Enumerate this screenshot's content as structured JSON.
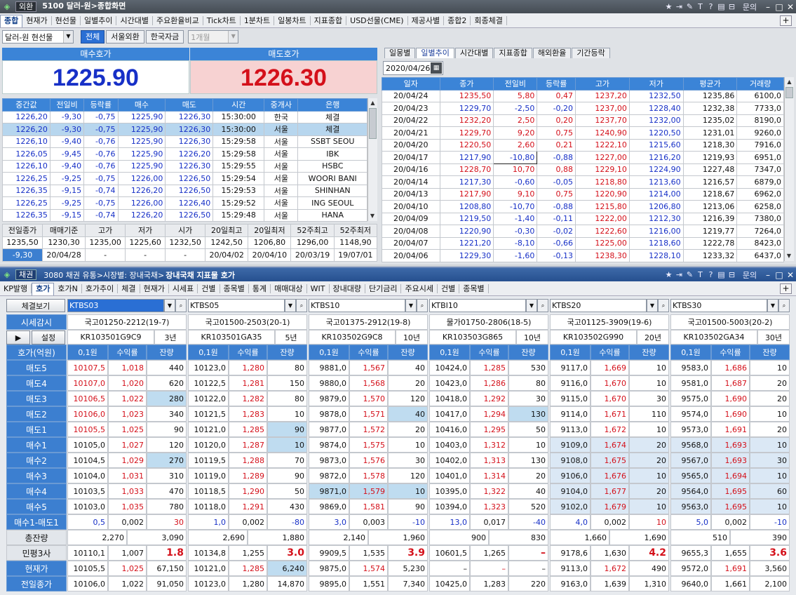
{
  "w1": {
    "tag": "외환",
    "chip": "5100 달러-원>종합화면",
    "menu": [
      "종합",
      "현재가",
      "현선물",
      "일별추이",
      "시간대별",
      "주요환율비교",
      "Tick차트",
      "1분차트",
      "일봉차트",
      "지표종합",
      "USD선물(CME)",
      "제공사별",
      "종합2",
      "회종체결"
    ],
    "sel": "달러-원 현선물",
    "seg": [
      "전체",
      "서울외환",
      "한국자금"
    ],
    "period": "1개월",
    "bid_label": "매수호가",
    "bid": "1225.90",
    "ask_label": "매도호가",
    "ask": "1226.30"
  },
  "trades": {
    "head": [
      "중간값",
      "전일비",
      "등락률",
      "매수",
      "매도",
      "시간",
      "중개사",
      "은행"
    ],
    "rows": [
      [
        "1226,20",
        "-9,30",
        "-0,75",
        "1225,90",
        "1226,30",
        "15:30:00",
        "한국",
        "체결"
      ],
      [
        "1226,20",
        "-9,30",
        "-0,75",
        "1225,90",
        "1226,30",
        "15:30:00",
        "서울",
        "체결"
      ],
      [
        "1226,10",
        "-9,40",
        "-0,76",
        "1225,90",
        "1226,30",
        "15:29:58",
        "서울",
        "SSBT SEOU"
      ],
      [
        "1226,05",
        "-9,45",
        "-0,76",
        "1225,90",
        "1226,20",
        "15:29:58",
        "서울",
        "IBK"
      ],
      [
        "1226,10",
        "-9,40",
        "-0,76",
        "1225,90",
        "1226,30",
        "15:29:55",
        "서울",
        "HSBC"
      ],
      [
        "1226,25",
        "-9,25",
        "-0,75",
        "1226,00",
        "1226,50",
        "15:29:54",
        "서울",
        "WOORI BANI"
      ],
      [
        "1226,35",
        "-9,15",
        "-0,74",
        "1226,20",
        "1226,50",
        "15:29:53",
        "서울",
        "SHINHAN"
      ],
      [
        "1226,25",
        "-9,25",
        "-0,75",
        "1226,00",
        "1226,40",
        "15:29:52",
        "서울",
        "ING SEOUL"
      ],
      [
        "1226,35",
        "-9,15",
        "-0,74",
        "1226,20",
        "1226,50",
        "15:29:48",
        "서울",
        "HANA"
      ]
    ]
  },
  "summary": {
    "head": [
      "전일종가",
      "매매기준",
      "고가",
      "저가",
      "시가",
      "20일최고",
      "20일최저",
      "52주최고",
      "52주최저"
    ],
    "r1": [
      "1235,50",
      "1230,30",
      "1235,00",
      "1225,60",
      "1232,50",
      "1242,50",
      "1206,80",
      "1296,00",
      "1148,90"
    ],
    "r2": [
      "-9,30",
      "20/04/28",
      "-",
      "-",
      "-",
      "20/04/02",
      "20/04/10",
      "20/03/19",
      "19/07/01"
    ]
  },
  "daily": {
    "tabs": [
      "일몽별",
      "일별추이",
      "시간대별",
      "지표종합",
      "해외환율",
      "기간등락"
    ],
    "date": "2020/04/26",
    "head": [
      "일자",
      "종가",
      "전일비",
      "등락률",
      "고가",
      "저가",
      "평균가",
      "거래량"
    ],
    "rows": [
      [
        "20/04/24",
        "1235,50",
        "5,80",
        "0,47",
        "1237,20",
        "1232,50",
        "1235,86",
        "6100,0"
      ],
      [
        "20/04/23",
        "1229,70",
        "-2,50",
        "-0,20",
        "1237,00",
        "1228,40",
        "1232,38",
        "7733,0"
      ],
      [
        "20/04/22",
        "1232,20",
        "2,50",
        "0,20",
        "1237,70",
        "1232,00",
        "1235,02",
        "8190,0"
      ],
      [
        "20/04/21",
        "1229,70",
        "9,20",
        "0,75",
        "1240,90",
        "1220,50",
        "1231,01",
        "9260,0"
      ],
      [
        "20/04/20",
        "1220,50",
        "2,60",
        "0,21",
        "1222,10",
        "1215,60",
        "1218,30",
        "7916,0"
      ],
      [
        "20/04/17",
        "1217,90",
        "-10,80",
        "-0,88",
        "1227,00",
        "1216,20",
        "1219,93",
        "6951,0"
      ],
      [
        "20/04/16",
        "1228,70",
        "10,70",
        "0,88",
        "1229,10",
        "1224,90",
        "1227,48",
        "7347,0"
      ],
      [
        "20/04/14",
        "1217,30",
        "-0,60",
        "-0,05",
        "1218,80",
        "1213,60",
        "1216,57",
        "6879,0"
      ],
      [
        "20/04/13",
        "1217,90",
        "9,10",
        "0,75",
        "1220,90",
        "1214,00",
        "1218,67",
        "6962,0"
      ],
      [
        "20/04/10",
        "1208,80",
        "-10,70",
        "-0,88",
        "1215,80",
        "1206,80",
        "1213,06",
        "6258,0"
      ],
      [
        "20/04/09",
        "1219,50",
        "-1,40",
        "-0,11",
        "1222,00",
        "1212,30",
        "1216,39",
        "7380,0"
      ],
      [
        "20/04/08",
        "1220,90",
        "-0,30",
        "-0,02",
        "1222,60",
        "1216,00",
        "1219,77",
        "7264,0"
      ],
      [
        "20/04/07",
        "1221,20",
        "-8,10",
        "-0,66",
        "1225,00",
        "1218,60",
        "1222,78",
        "8423,0"
      ],
      [
        "20/04/06",
        "1229,30",
        "-1,60",
        "-0,13",
        "1238,30",
        "1228,10",
        "1233,32",
        "6437,0"
      ]
    ]
  },
  "w2": {
    "tag": "채권",
    "chip": "3080 채권 유통>시장별: 장내국채>",
    "title": "장내국채 지표물 호가",
    "menu": [
      "KP발행",
      "호가",
      "호가N",
      "호가추이",
      "체결",
      "현재가",
      "시세표",
      "건별",
      "종목별",
      "통계",
      "매매대상",
      "WIT",
      "장내대량",
      "단기금리",
      "주요시세",
      "건별",
      "종목별"
    ],
    "btn_check": "체결보기",
    "btn_watch": "시세감시",
    "btn_play": "▶",
    "btn_set": "설정",
    "hdr_quote": "호가(억원)",
    "col_hdr": [
      "0,1원",
      "수익률",
      "잔량"
    ],
    "labels": [
      "매도5",
      "매도4",
      "매도3",
      "매도2",
      "매도1",
      "매수1",
      "매수2",
      "매수3",
      "매수4",
      "매수5",
      "매수1-매도1",
      "총잔량",
      "민평3사",
      "현재가",
      "전일종가"
    ],
    "instruments": [
      {
        "code": "KTBS03",
        "name": "국고01250-2212(19-7)",
        "isin": "KR103501G9C9",
        "tenor": "3년",
        "ask": [
          [
            "10107,5",
            "1,018",
            "440"
          ],
          [
            "10107,0",
            "1,020",
            "620"
          ],
          [
            "10106,5",
            "1,022",
            "280"
          ],
          [
            "10106,0",
            "1,023",
            "340"
          ],
          [
            "10105,5",
            "1,025",
            "90"
          ]
        ],
        "bid": [
          [
            "10105,0",
            "1,027",
            "120"
          ],
          [
            "10104,5",
            "1,029",
            "270"
          ],
          [
            "10104,0",
            "1,031",
            "310"
          ],
          [
            "10103,5",
            "1,033",
            "470"
          ],
          [
            "10103,0",
            "1,035",
            "780"
          ]
        ],
        "spread": [
          "0,5",
          "0,002",
          "30"
        ],
        "total": [
          "2,270",
          "3,090"
        ],
        "minp": [
          "10110,1",
          "1,007",
          "1.8"
        ],
        "cur": [
          "10105,5",
          "1,025",
          "67,150"
        ],
        "prev": [
          "10106,0",
          "1,022",
          "91,050"
        ]
      },
      {
        "code": "KTBS05",
        "name": "국고01500-2503(20-1)",
        "isin": "KR103501GA35",
        "tenor": "5년",
        "ask": [
          [
            "10123,0",
            "1,280",
            "80"
          ],
          [
            "10122,5",
            "1,281",
            "150"
          ],
          [
            "10122,0",
            "1,282",
            "80"
          ],
          [
            "10121,5",
            "1,283",
            "10"
          ],
          [
            "10121,0",
            "1,285",
            "90"
          ]
        ],
        "bid": [
          [
            "10120,0",
            "1,287",
            "10"
          ],
          [
            "10119,5",
            "1,288",
            "70"
          ],
          [
            "10119,0",
            "1,289",
            "90"
          ],
          [
            "10118,5",
            "1,290",
            "50"
          ],
          [
            "10118,0",
            "1,291",
            "430"
          ]
        ],
        "spread": [
          "1,0",
          "0,002",
          "-80"
        ],
        "total": [
          "2,690",
          "1,880"
        ],
        "minp": [
          "10134,8",
          "1,255",
          "3.0"
        ],
        "cur": [
          "10121,0",
          "1,285",
          "6,240"
        ],
        "prev": [
          "10123,0",
          "1,280",
          "14,870"
        ]
      },
      {
        "code": "KTBS10",
        "name": "국고01375-2912(19-8)",
        "isin": "KR103502G9C8",
        "tenor": "10년",
        "ask": [
          [
            "9881,0",
            "1,567",
            "40"
          ],
          [
            "9880,0",
            "1,568",
            "20"
          ],
          [
            "9879,0",
            "1,570",
            "120"
          ],
          [
            "9878,0",
            "1,571",
            "40"
          ],
          [
            "9877,0",
            "1,572",
            "20"
          ]
        ],
        "bid": [
          [
            "9874,0",
            "1,575",
            "10"
          ],
          [
            "9873,0",
            "1,576",
            "30"
          ],
          [
            "9872,0",
            "1,578",
            "120"
          ],
          [
            "9871,0",
            "1,579",
            "10"
          ],
          [
            "9869,0",
            "1,581",
            "90"
          ]
        ],
        "spread": [
          "3,0",
          "0,003",
          "-10"
        ],
        "total": [
          "2,140",
          "1,960"
        ],
        "minp": [
          "9909,5",
          "1,535",
          "3.9"
        ],
        "cur": [
          "9875,0",
          "1,574",
          "5,230"
        ],
        "prev": [
          "9895,0",
          "1,551",
          "7,340"
        ]
      },
      {
        "code": "KTBI10",
        "name": "물가01750-2806(18-5)",
        "isin": "KR103503G865",
        "tenor": "10년",
        "ask": [
          [
            "10424,0",
            "1,285",
            "530"
          ],
          [
            "10423,0",
            "1,286",
            "80"
          ],
          [
            "10418,0",
            "1,292",
            "30"
          ],
          [
            "10417,0",
            "1,294",
            "130"
          ],
          [
            "10416,0",
            "1,295",
            "50"
          ]
        ],
        "bid": [
          [
            "10403,0",
            "1,312",
            "10"
          ],
          [
            "10402,0",
            "1,313",
            "130"
          ],
          [
            "10401,0",
            "1,314",
            "20"
          ],
          [
            "10395,0",
            "1,322",
            "40"
          ],
          [
            "10394,0",
            "1,323",
            "520"
          ]
        ],
        "spread": [
          "13,0",
          "0,017",
          "-40"
        ],
        "total": [
          "900",
          "830"
        ],
        "minp": [
          "10601,5",
          "1,265",
          "–"
        ],
        "cur": [
          "–",
          "–",
          "–"
        ],
        "prev": [
          "10425,0",
          "1,283",
          "220"
        ]
      },
      {
        "code": "KTBS20",
        "name": "국고01125-3909(19-6)",
        "isin": "KR103502G990",
        "tenor": "20년",
        "ask": [
          [
            "9117,0",
            "1,669",
            "10"
          ],
          [
            "9116,0",
            "1,670",
            "10"
          ],
          [
            "9115,0",
            "1,670",
            "30"
          ],
          [
            "9114,0",
            "1,671",
            "110"
          ],
          [
            "9113,0",
            "1,672",
            "10"
          ]
        ],
        "bid": [
          [
            "9109,0",
            "1,674",
            "20"
          ],
          [
            "9108,0",
            "1,675",
            "20"
          ],
          [
            "9106,0",
            "1,676",
            "10"
          ],
          [
            "9104,0",
            "1,677",
            "20"
          ],
          [
            "9102,0",
            "1,679",
            "10"
          ]
        ],
        "spread": [
          "4,0",
          "0,002",
          "10"
        ],
        "total": [
          "1,660",
          "1,690"
        ],
        "minp": [
          "9178,6",
          "1,630",
          "4.2"
        ],
        "cur": [
          "9113,0",
          "1,672",
          "490"
        ],
        "prev": [
          "9163,0",
          "1,639",
          "1,310"
        ]
      },
      {
        "code": "KTBS30",
        "name": "국고01500-5003(20-2)",
        "isin": "KR103502GA34",
        "tenor": "30년",
        "ask": [
          [
            "9583,0",
            "1,686",
            "10"
          ],
          [
            "9581,0",
            "1,687",
            "20"
          ],
          [
            "9575,0",
            "1,690",
            "20"
          ],
          [
            "9574,0",
            "1,690",
            "10"
          ],
          [
            "9573,0",
            "1,691",
            "20"
          ]
        ],
        "bid": [
          [
            "9568,0",
            "1,693",
            "10"
          ],
          [
            "9567,0",
            "1,693",
            "30"
          ],
          [
            "9565,0",
            "1,694",
            "10"
          ],
          [
            "9564,0",
            "1,695",
            "60"
          ],
          [
            "9563,0",
            "1,695",
            "10"
          ]
        ],
        "spread": [
          "5,0",
          "0,002",
          "-10"
        ],
        "total": [
          "510",
          "390"
        ],
        "minp": [
          "9655,3",
          "1,655",
          "3.6"
        ],
        "cur": [
          "9572,0",
          "1,691",
          "3,560"
        ],
        "prev": [
          "9640,0",
          "1,661",
          "2,100"
        ]
      }
    ]
  }
}
